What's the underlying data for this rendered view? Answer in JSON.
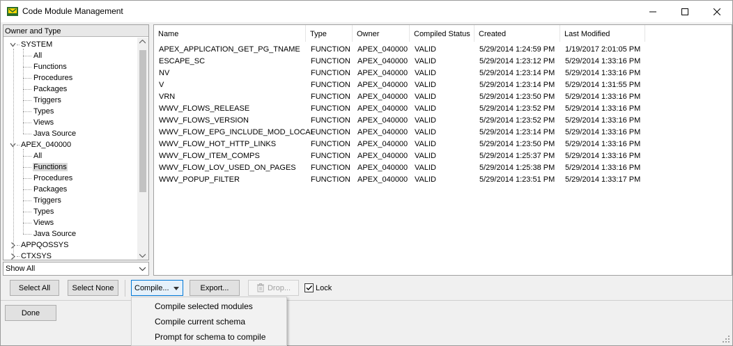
{
  "window": {
    "title": "Code Module Management"
  },
  "tree": {
    "header": "Owner and Type",
    "nodes": [
      {
        "label": "SYSTEM",
        "level": 0,
        "expanded": true
      },
      {
        "label": "All",
        "level": 1
      },
      {
        "label": "Functions",
        "level": 1
      },
      {
        "label": "Procedures",
        "level": 1
      },
      {
        "label": "Packages",
        "level": 1
      },
      {
        "label": "Triggers",
        "level": 1
      },
      {
        "label": "Types",
        "level": 1
      },
      {
        "label": "Views",
        "level": 1
      },
      {
        "label": "Java Source",
        "level": 1
      },
      {
        "label": "APEX_040000",
        "level": 0,
        "expanded": true
      },
      {
        "label": "All",
        "level": 1
      },
      {
        "label": "Functions",
        "level": 1,
        "selected": true
      },
      {
        "label": "Procedures",
        "level": 1
      },
      {
        "label": "Packages",
        "level": 1
      },
      {
        "label": "Triggers",
        "level": 1
      },
      {
        "label": "Types",
        "level": 1
      },
      {
        "label": "Views",
        "level": 1
      },
      {
        "label": "Java Source",
        "level": 1
      },
      {
        "label": "APPQOSSYS",
        "level": 0,
        "expanded": false
      },
      {
        "label": "CTXSYS",
        "level": 0,
        "expanded": false
      }
    ]
  },
  "filter": {
    "selected": "Show All"
  },
  "table": {
    "columns": [
      "Name",
      "Type",
      "Owner",
      "Compiled Status",
      "Created",
      "Last Modified"
    ],
    "rows": [
      [
        "APEX_APPLICATION_GET_PG_TNAME",
        "FUNCTION",
        "APEX_040000",
        "VALID",
        "5/29/2014 1:24:59 PM",
        "1/19/2017 2:01:05 PM"
      ],
      [
        "ESCAPE_SC",
        "FUNCTION",
        "APEX_040000",
        "VALID",
        "5/29/2014 1:23:12 PM",
        "5/29/2014 1:33:16 PM"
      ],
      [
        "NV",
        "FUNCTION",
        "APEX_040000",
        "VALID",
        "5/29/2014 1:23:14 PM",
        "5/29/2014 1:33:16 PM"
      ],
      [
        "V",
        "FUNCTION",
        "APEX_040000",
        "VALID",
        "5/29/2014 1:23:14 PM",
        "5/29/2014 1:31:55 PM"
      ],
      [
        "VRN",
        "FUNCTION",
        "APEX_040000",
        "VALID",
        "5/29/2014 1:23:50 PM",
        "5/29/2014 1:33:16 PM"
      ],
      [
        "WWV_FLOWS_RELEASE",
        "FUNCTION",
        "APEX_040000",
        "VALID",
        "5/29/2014 1:23:52 PM",
        "5/29/2014 1:33:16 PM"
      ],
      [
        "WWV_FLOWS_VERSION",
        "FUNCTION",
        "APEX_040000",
        "VALID",
        "5/29/2014 1:23:52 PM",
        "5/29/2014 1:33:16 PM"
      ],
      [
        "WWV_FLOW_EPG_INCLUDE_MOD_LOCAL",
        "FUNCTION",
        "APEX_040000",
        "VALID",
        "5/29/2014 1:23:14 PM",
        "5/29/2014 1:33:16 PM"
      ],
      [
        "WWV_FLOW_HOT_HTTP_LINKS",
        "FUNCTION",
        "APEX_040000",
        "VALID",
        "5/29/2014 1:23:50 PM",
        "5/29/2014 1:33:16 PM"
      ],
      [
        "WWV_FLOW_ITEM_COMPS",
        "FUNCTION",
        "APEX_040000",
        "VALID",
        "5/29/2014 1:25:37 PM",
        "5/29/2014 1:33:16 PM"
      ],
      [
        "WWV_FLOW_LOV_USED_ON_PAGES",
        "FUNCTION",
        "APEX_040000",
        "VALID",
        "5/29/2014 1:25:38 PM",
        "5/29/2014 1:33:16 PM"
      ],
      [
        "WWV_POPUP_FILTER",
        "FUNCTION",
        "APEX_040000",
        "VALID",
        "5/29/2014 1:23:51 PM",
        "5/29/2014 1:33:17 PM"
      ]
    ]
  },
  "toolbar": {
    "select_all": "Select All",
    "select_none": "Select None",
    "compile": "Compile...",
    "export": "Export...",
    "drop": "Drop...",
    "lock_label": "Lock",
    "lock_checked": true
  },
  "menu": {
    "items": [
      "Compile selected modules",
      "Compile current schema",
      "Prompt for schema to compile"
    ]
  },
  "footer": {
    "done": "Done"
  },
  "icons": {
    "app": "app-icon",
    "minimize": "minimize-icon",
    "maximize": "maximize-icon",
    "close": "close-icon",
    "drop": "trash-icon",
    "dropdown": "chevron-down-icon"
  }
}
